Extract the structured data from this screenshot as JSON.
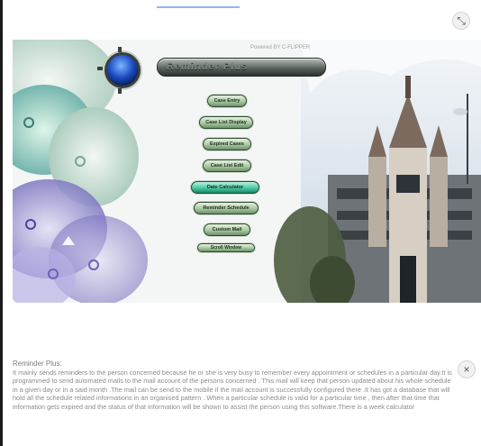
{
  "banner": {
    "powered_by": "Powered BY C-FLIPPER",
    "app_title": "Reminder Plus"
  },
  "menu": {
    "items": [
      {
        "label": "Case Entry"
      },
      {
        "label": "Case List Display"
      },
      {
        "label": "Expired Cases"
      },
      {
        "label": "Case List Edit"
      },
      {
        "label": "Date Calculator"
      },
      {
        "label": "Reminder Schedule"
      },
      {
        "label": "Custom Mail"
      },
      {
        "label": "Scroll Window"
      }
    ]
  },
  "controls": {
    "expand_icon": "expand-arrows-icon",
    "close_icon": "close-x-icon",
    "close_glyph": "×",
    "expand_glyph": "⤡"
  },
  "description": {
    "heading": "Reminder Plus:",
    "body": "It mainly sends reminders to the person concerned because he or she is very busy to remember every appointment or schedules in a particular day.It is programmed to send automated mails to the mail account of the persons concerned . This mail will keep that person updated about his whole schedule in a given day or in a said month .The mail can be send to the mobile if the mail account is successfully configured there .It has got a database that will hold all the schedule related informations in an organised pattern . When a particular schedule is valid for a particular time , then after that time that information gets expired and the status of that information will be shown to assist the person using this software.There is a week calculator"
  },
  "colors": {
    "active_button": "#4cc9a4",
    "button": "#a9c7a1",
    "caption_text": "#8c8c8c"
  }
}
